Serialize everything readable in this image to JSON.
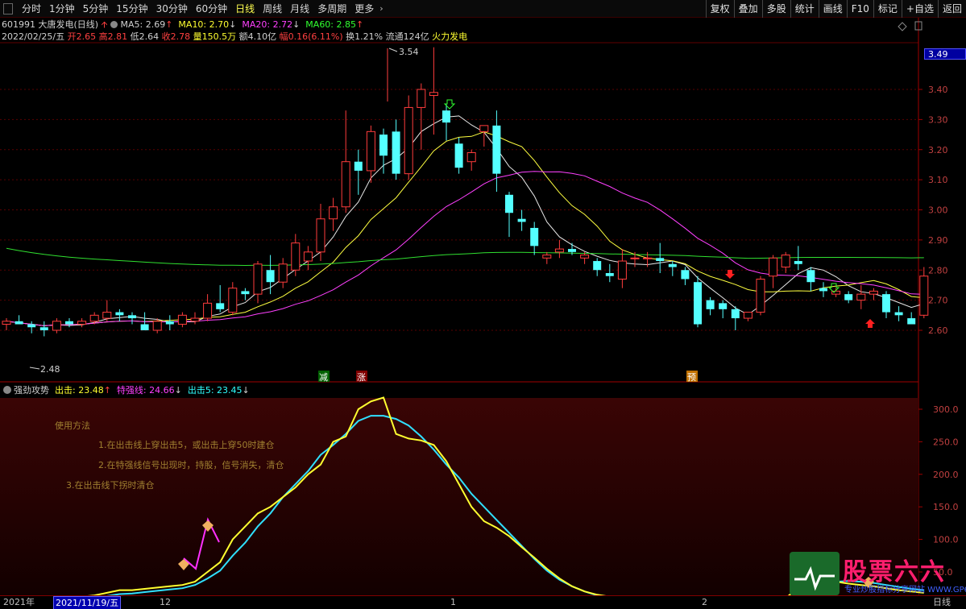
{
  "toolbar": {
    "periods": [
      "分时",
      "1分钟",
      "5分钟",
      "15分钟",
      "30分钟",
      "60分钟",
      "日线",
      "周线",
      "月线",
      "多周期",
      "更多"
    ],
    "active_period": "日线",
    "right_buttons": [
      "复权",
      "叠加",
      "多股",
      "统计",
      "画线",
      "F10",
      "标记",
      "+自选",
      "返回"
    ]
  },
  "stock": {
    "code_name": "601991 大唐发电(日线)",
    "ma5": "MA5: 2.69",
    "ma10": "MA10: 2.70",
    "ma20": "MA20: 2.72",
    "ma60": "MA60: 2.85",
    "date": "2022/02/25/五",
    "open": "开2.65",
    "high": "高2.81",
    "low": "低2.64",
    "close": "收2.78",
    "volume": "量150.5万",
    "amount": "额4.10亿",
    "change": "幅0.16(6.11%)",
    "turnover": "换1.21%",
    "float": "流通124亿",
    "concept": "火力发电"
  },
  "price_axis": {
    "ticks": [
      "3.40",
      "3.30",
      "3.20",
      "3.10",
      "3.00",
      "2.90",
      "2.80",
      "2.70",
      "2.60"
    ],
    "current": "3.49"
  },
  "annotations": {
    "high_label": "3.54",
    "low_label": "2.48",
    "tag_jian": "减",
    "tag_zhang": "涨",
    "tag_yu": "预"
  },
  "indicator": {
    "name": "强劲攻势",
    "chuji": "出击: 23.48",
    "teqiang": "特强线: 24.66",
    "chuji5": "出击5: 23.45",
    "ticks": [
      "300.0",
      "250.0",
      "200.0",
      "150.0",
      "100.0",
      "50.0"
    ],
    "notes": [
      "使用方法",
      "1.在出击线上穿出击5，或出击上穿50时建仓",
      "2.在特强线信号出现时，持股，信号消失，清仓",
      "3.在出击线下拐时清仓"
    ]
  },
  "dates": {
    "year": "2021年",
    "current": "2021/11/19/五",
    "m12": "12",
    "m1": "1",
    "m2": "2",
    "period_label": "日线"
  },
  "watermark": {
    "title": "股票六六",
    "subtitle": "专业炒股指标分享网站 WWW.GP66.CN"
  },
  "candles": [
    [
      2.62,
      2.64,
      2.6,
      2.63
    ],
    [
      2.63,
      2.65,
      2.62,
      2.62
    ],
    [
      2.62,
      2.63,
      2.59,
      2.61
    ],
    [
      2.61,
      2.63,
      2.58,
      2.6
    ],
    [
      2.6,
      2.64,
      2.59,
      2.63
    ],
    [
      2.63,
      2.64,
      2.61,
      2.62
    ],
    [
      2.62,
      2.64,
      2.61,
      2.63
    ],
    [
      2.63,
      2.66,
      2.62,
      2.65
    ],
    [
      2.64,
      2.7,
      2.63,
      2.66
    ],
    [
      2.66,
      2.67,
      2.63,
      2.65
    ],
    [
      2.65,
      2.66,
      2.62,
      2.64
    ],
    [
      2.62,
      2.66,
      2.61,
      2.6
    ],
    [
      2.6,
      2.64,
      2.59,
      2.63
    ],
    [
      2.63,
      2.65,
      2.6,
      2.62
    ],
    [
      2.62,
      2.66,
      2.61,
      2.65
    ],
    [
      2.63,
      2.66,
      2.62,
      2.64
    ],
    [
      2.64,
      2.72,
      2.63,
      2.69
    ],
    [
      2.69,
      2.75,
      2.66,
      2.67
    ],
    [
      2.66,
      2.76,
      2.65,
      2.74
    ],
    [
      2.73,
      2.74,
      2.7,
      2.72
    ],
    [
      2.72,
      2.83,
      2.69,
      2.82
    ],
    [
      2.8,
      2.85,
      2.72,
      2.76
    ],
    [
      2.76,
      2.84,
      2.74,
      2.82
    ],
    [
      2.8,
      2.92,
      2.78,
      2.89
    ],
    [
      2.83,
      2.88,
      2.8,
      2.86
    ],
    [
      2.86,
      3.02,
      2.83,
      2.97
    ],
    [
      2.97,
      3.04,
      2.93,
      3.01
    ],
    [
      3.01,
      3.33,
      2.99,
      3.16
    ],
    [
      3.16,
      3.2,
      3.05,
      3.13
    ],
    [
      3.13,
      3.28,
      3.09,
      3.26
    ],
    [
      3.25,
      3.27,
      3.12,
      3.18
    ],
    [
      3.26,
      3.3,
      3.1,
      3.12
    ],
    [
      3.12,
      3.38,
      3.1,
      3.34
    ],
    [
      3.34,
      3.42,
      3.2,
      3.4
    ],
    [
      3.38,
      3.54,
      3.25,
      3.39
    ],
    [
      3.33,
      3.35,
      3.23,
      3.29
    ],
    [
      3.22,
      3.24,
      3.12,
      3.14
    ],
    [
      3.16,
      3.2,
      3.13,
      3.19
    ],
    [
      3.26,
      3.27,
      3.21,
      3.28
    ],
    [
      3.28,
      3.33,
      3.06,
      3.12
    ],
    [
      3.05,
      3.06,
      2.91,
      2.99
    ],
    [
      2.97,
      3.0,
      2.93,
      2.96
    ],
    [
      2.94,
      2.96,
      2.85,
      2.88
    ],
    [
      2.84,
      2.86,
      2.82,
      2.85
    ],
    [
      2.86,
      2.9,
      2.84,
      2.87
    ],
    [
      2.87,
      2.89,
      2.85,
      2.86
    ],
    [
      2.84,
      2.86,
      2.82,
      2.85
    ],
    [
      2.83,
      2.84,
      2.78,
      2.8
    ],
    [
      2.79,
      2.82,
      2.76,
      2.78
    ],
    [
      2.77,
      2.87,
      2.74,
      2.83
    ],
    [
      2.84,
      2.86,
      2.81,
      2.84
    ],
    [
      2.84,
      2.86,
      2.81,
      2.84
    ],
    [
      2.84,
      2.89,
      2.79,
      2.83
    ],
    [
      2.82,
      2.83,
      2.78,
      2.81
    ],
    [
      2.8,
      2.81,
      2.75,
      2.77
    ],
    [
      2.76,
      2.78,
      2.61,
      2.62
    ],
    [
      2.7,
      2.71,
      2.65,
      2.67
    ],
    [
      2.69,
      2.7,
      2.64,
      2.67
    ],
    [
      2.67,
      2.68,
      2.6,
      2.64
    ],
    [
      2.64,
      2.66,
      2.63,
      2.66
    ],
    [
      2.66,
      2.78,
      2.65,
      2.77
    ],
    [
      2.78,
      2.85,
      2.74,
      2.84
    ],
    [
      2.81,
      2.86,
      2.79,
      2.85
    ],
    [
      2.83,
      2.88,
      2.8,
      2.82
    ],
    [
      2.8,
      2.81,
      2.73,
      2.76
    ],
    [
      2.74,
      2.76,
      2.71,
      2.73
    ],
    [
      2.72,
      2.74,
      2.71,
      2.73
    ],
    [
      2.72,
      2.73,
      2.69,
      2.7
    ],
    [
      2.7,
      2.75,
      2.67,
      2.72
    ],
    [
      2.72,
      2.74,
      2.7,
      2.73
    ],
    [
      2.72,
      2.73,
      2.64,
      2.66
    ],
    [
      2.66,
      2.68,
      2.63,
      2.65
    ],
    [
      2.64,
      2.66,
      2.63,
      2.62
    ],
    [
      2.65,
      2.81,
      2.64,
      2.78
    ]
  ]
}
